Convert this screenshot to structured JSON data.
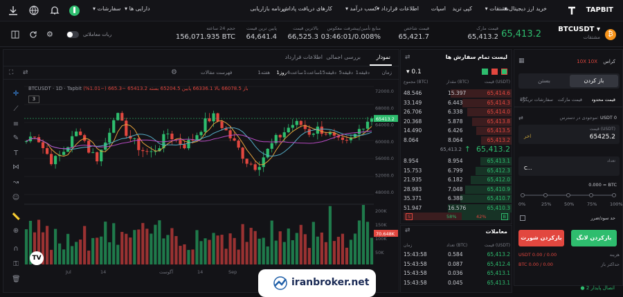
{
  "nav": {
    "logo": "TAPBIT",
    "items": [
      "خرید ارز دیجیتال",
      "مشتقات",
      "کپی ترید",
      "اسپات",
      "اطلاعات قرارداد",
      "کسب درآمد",
      "کارهای دریافت پاداش",
      "برنامه بازاریابی"
    ],
    "right": [
      "سفارشات",
      "دارایی ها"
    ]
  },
  "ticker": {
    "pair": "BTCUSDT",
    "pair_sub": "مشتقات",
    "price": "65,413.2",
    "stats": [
      {
        "label": "قیمت مارک",
        "value": "65,413.2"
      },
      {
        "label": "قیمت شاخص",
        "value": "65,421.7"
      },
      {
        "label": "منابع تأمین/پیشرفت معکوس",
        "value": "03:46:01/0.008%"
      },
      {
        "label": "بالاترین قیمت",
        "value": "66,525.3"
      },
      {
        "label": "پایین ترین قیمت",
        "value": "64,641.4"
      },
      {
        "label": "حجم 24 ساعته",
        "value": "156,071.935 BTC"
      }
    ],
    "toggle_label": "ربات معاملاتی"
  },
  "chart": {
    "tabs": [
      "نمودار",
      "بررسی اجمالی",
      "اطلاعات قرارداد"
    ],
    "intervals": [
      "زمان",
      "1دقیقه",
      "5دقیقه",
      "15دقیقه",
      "1ساعت",
      "4ساعت",
      "1روز",
      "1هفته"
    ],
    "indicators_label": "فهرست مقالات",
    "legend": "BTCUSDT · 1D · Tapbit",
    "ohlc": "باز 66078.5  بالا 66336.1  پایین 65204.5  بسته 65413.2  −665.3 (−1.01%)",
    "ma_badge": "3",
    "price_label": "65413.2",
    "vol_label": "70.648K",
    "yticks": [
      "72000.0",
      "68000.0",
      "64000.0",
      "60000.0",
      "56000.0",
      "52000.0",
      "48000.0"
    ],
    "vticks": [
      "200K",
      "150K",
      "100K",
      "50K"
    ],
    "xticks": [
      "Jul",
      "14",
      "آگوست",
      "14",
      "Sep",
      "14"
    ]
  },
  "chart_data": {
    "type": "bar",
    "ylim": [
      45000,
      73000
    ],
    "last": 65413.2
  },
  "orderbook": {
    "title": "لیست تمام سفارش ها",
    "step": "0.1",
    "headers": [
      "قیمت (USDT)",
      "مقدار (BTC)",
      "مجموع (BTC)"
    ],
    "asks": [
      [
        "65,414.6",
        "15.397",
        "48.546"
      ],
      [
        "65,414.3",
        "6.443",
        "33.149"
      ],
      [
        "65,414.0",
        "6.338",
        "26.706"
      ],
      [
        "65,413.8",
        "5.878",
        "20.368"
      ],
      [
        "65,413.5",
        "6.426",
        "14.490"
      ],
      [
        "65,413.2",
        "8.064",
        "8.064"
      ]
    ],
    "mid": "65,413.2",
    "mid_sub": "65,413.2",
    "bids": [
      [
        "65,413.1",
        "8.954",
        "8.954"
      ],
      [
        "65,412.3",
        "6.799",
        "15.753"
      ],
      [
        "65,412.0",
        "6.182",
        "21.935"
      ],
      [
        "65,410.9",
        "7.048",
        "28.983"
      ],
      [
        "65,410.7",
        "6.388",
        "35.371"
      ],
      [
        "65,410.3",
        "16.576",
        "51.947"
      ]
    ],
    "buy_pct": "58%",
    "sell_pct": "42%",
    "b": "B",
    "s": "S"
  },
  "trades": {
    "title": "معاملات",
    "headers": [
      "قیمت (USDT)",
      "تعداد (BTC)",
      "زمان"
    ],
    "rows": [
      [
        "65,413.2",
        "0.584",
        "15:43:58"
      ],
      [
        "65,412.4",
        "0.087",
        "15:43:58"
      ],
      [
        "65,413.1",
        "0.036",
        "15:43:58"
      ],
      [
        "65,413.1",
        "0.045",
        "15:43:58"
      ]
    ]
  },
  "order": {
    "mode": "کراس",
    "lev": "10X",
    "lev2": "10X",
    "tab_buy": "باز کردن",
    "tab_sell": "بستن",
    "types": [
      "قیمت محدود",
      "قیمت مارکت",
      "سفارشات تریگر"
    ],
    "avail": "USDT 0",
    "avail_label": "موجودی در دسترس",
    "price_label": "قیمت (USDT)",
    "price": "65425.2",
    "bbo": "اخر",
    "amount_label": "تعداد",
    "amount": "BTC",
    "amount_val": "0.000 = BTC",
    "currency": "C...",
    "pcts": [
      "0%",
      "25%",
      "50%",
      "75%",
      "100%"
    ],
    "tpsl": "حد سود/ضرر",
    "long": "بازکردن لانگ",
    "short": "بازکردن شورت",
    "cost_label": "هزینه",
    "cost": "USDT 0.00 / 0.00",
    "max_label": "حداکثر باز",
    "max": "BTC 0.00 / 0.00"
  },
  "footer": {
    "status": "اتصال پایدار 2"
  },
  "watermark": "iranbroker.net"
}
